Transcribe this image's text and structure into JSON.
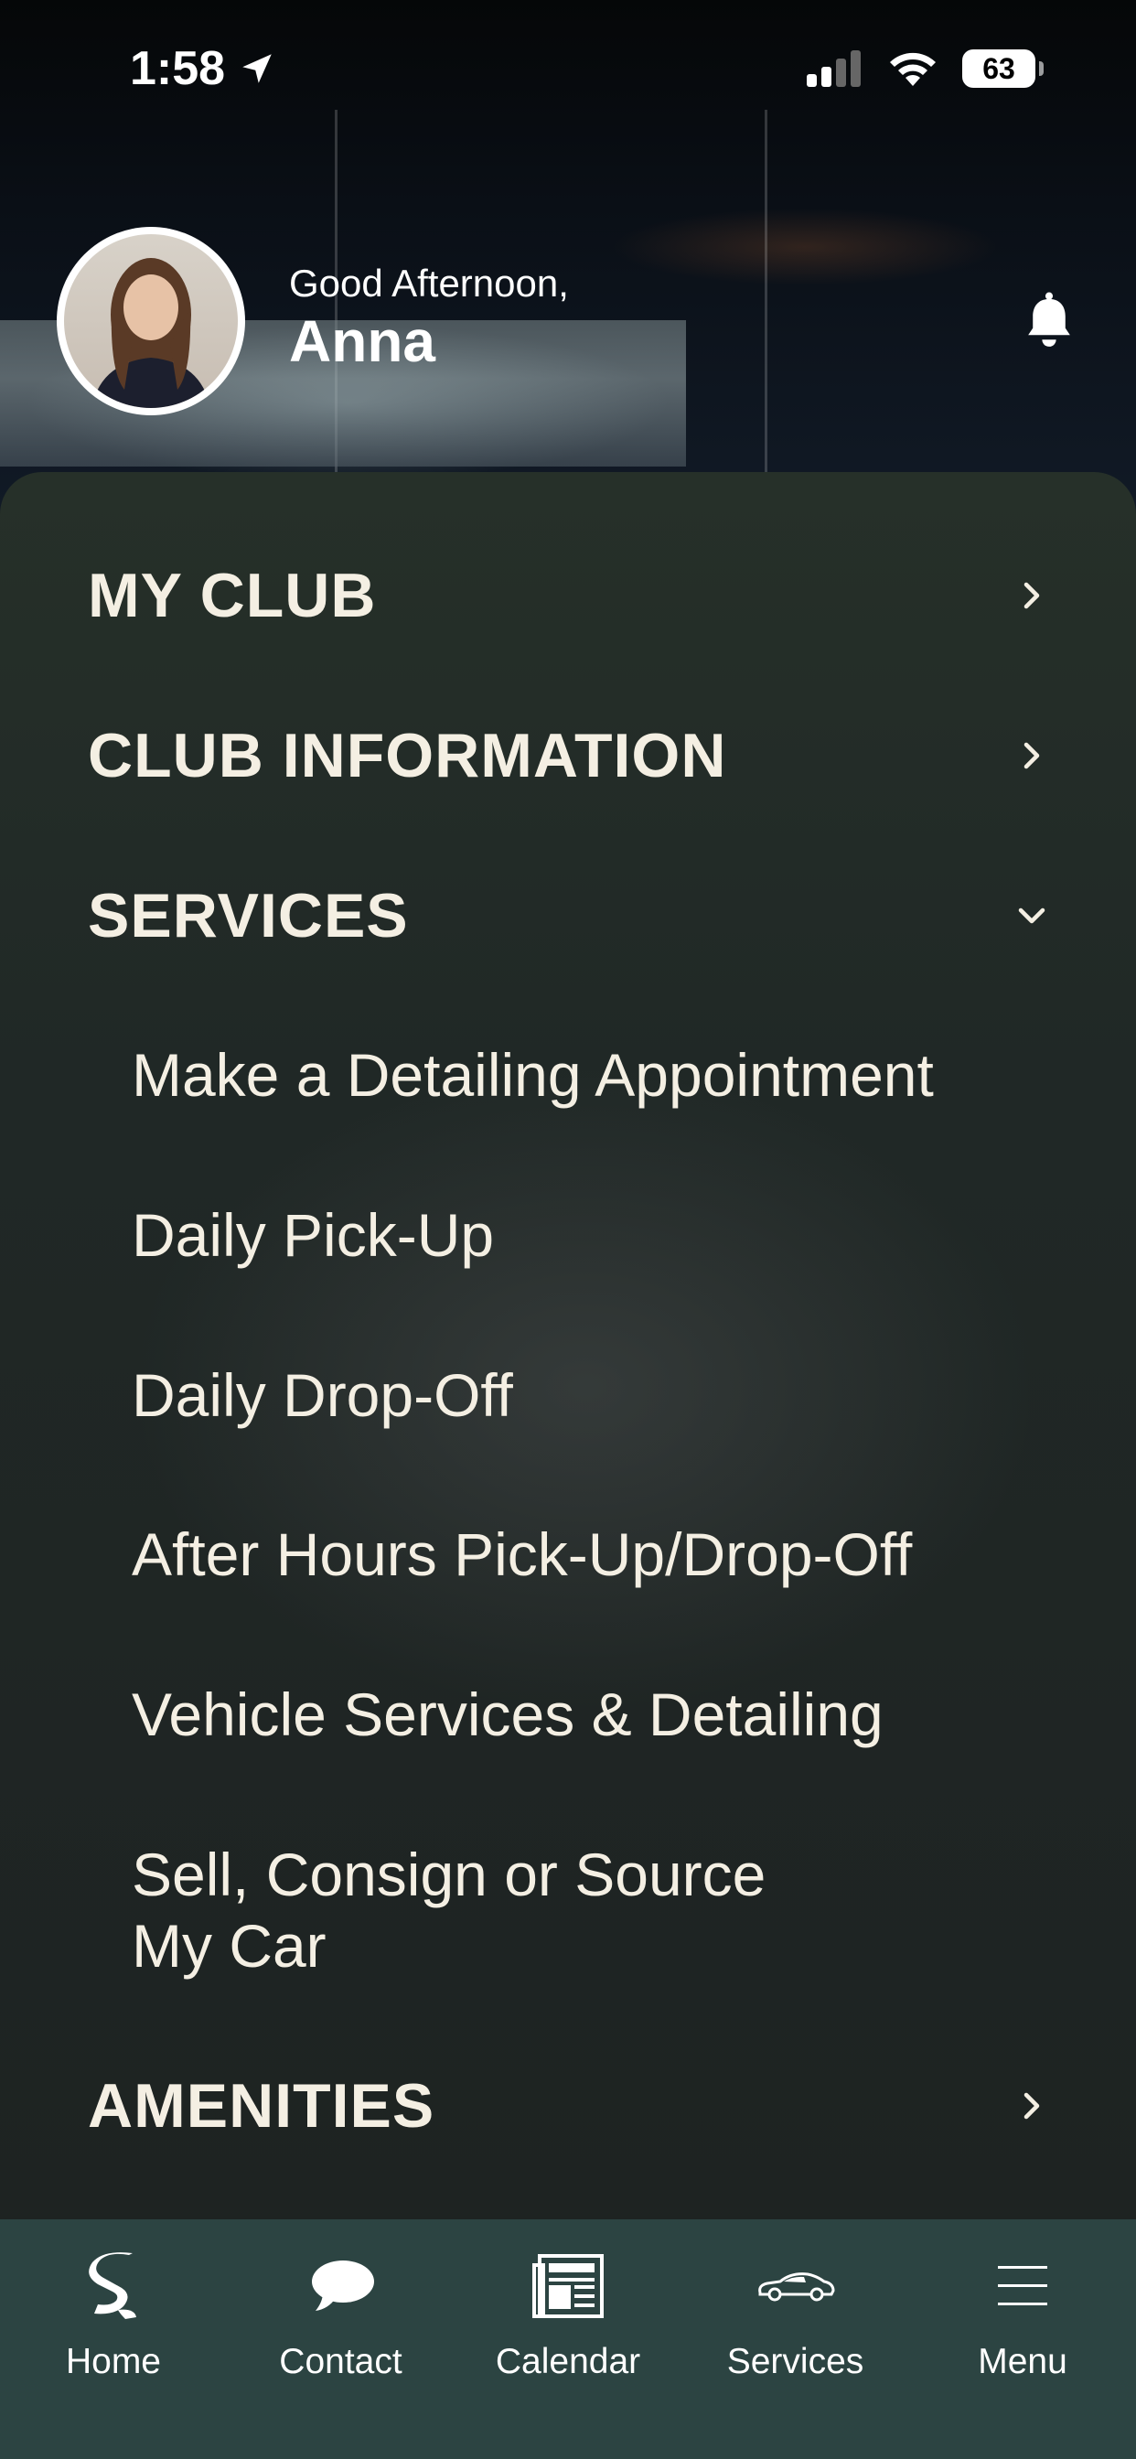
{
  "status_bar": {
    "time": "1:58",
    "battery": "63"
  },
  "profile": {
    "greeting": "Good Afternoon,",
    "name": "Anna"
  },
  "menu": {
    "sections": [
      {
        "label": "MY CLUB",
        "state": "collapsed"
      },
      {
        "label": "CLUB INFORMATION",
        "state": "collapsed"
      },
      {
        "label": "SERVICES",
        "state": "expanded"
      },
      {
        "label": "AMENITIES",
        "state": "collapsed"
      }
    ],
    "services_items": [
      "Make a Detailing Appointment",
      "Daily Pick-Up",
      "Daily Drop-Off",
      "After Hours Pick-Up/Drop-Off",
      "Vehicle Services & Detailing",
      "Sell, Consign or Source My Car"
    ]
  },
  "tabbar": {
    "tabs": [
      {
        "label": "Home",
        "icon": "logo-s-icon"
      },
      {
        "label": "Contact",
        "icon": "chat-bubble-icon"
      },
      {
        "label": "Calendar",
        "icon": "newspaper-icon"
      },
      {
        "label": "Services",
        "icon": "car-icon"
      },
      {
        "label": "Menu",
        "icon": "hamburger-icon"
      }
    ]
  },
  "colors": {
    "panel": "#222a28",
    "tabbar": "#2c4442",
    "text": "#f4efe3"
  }
}
